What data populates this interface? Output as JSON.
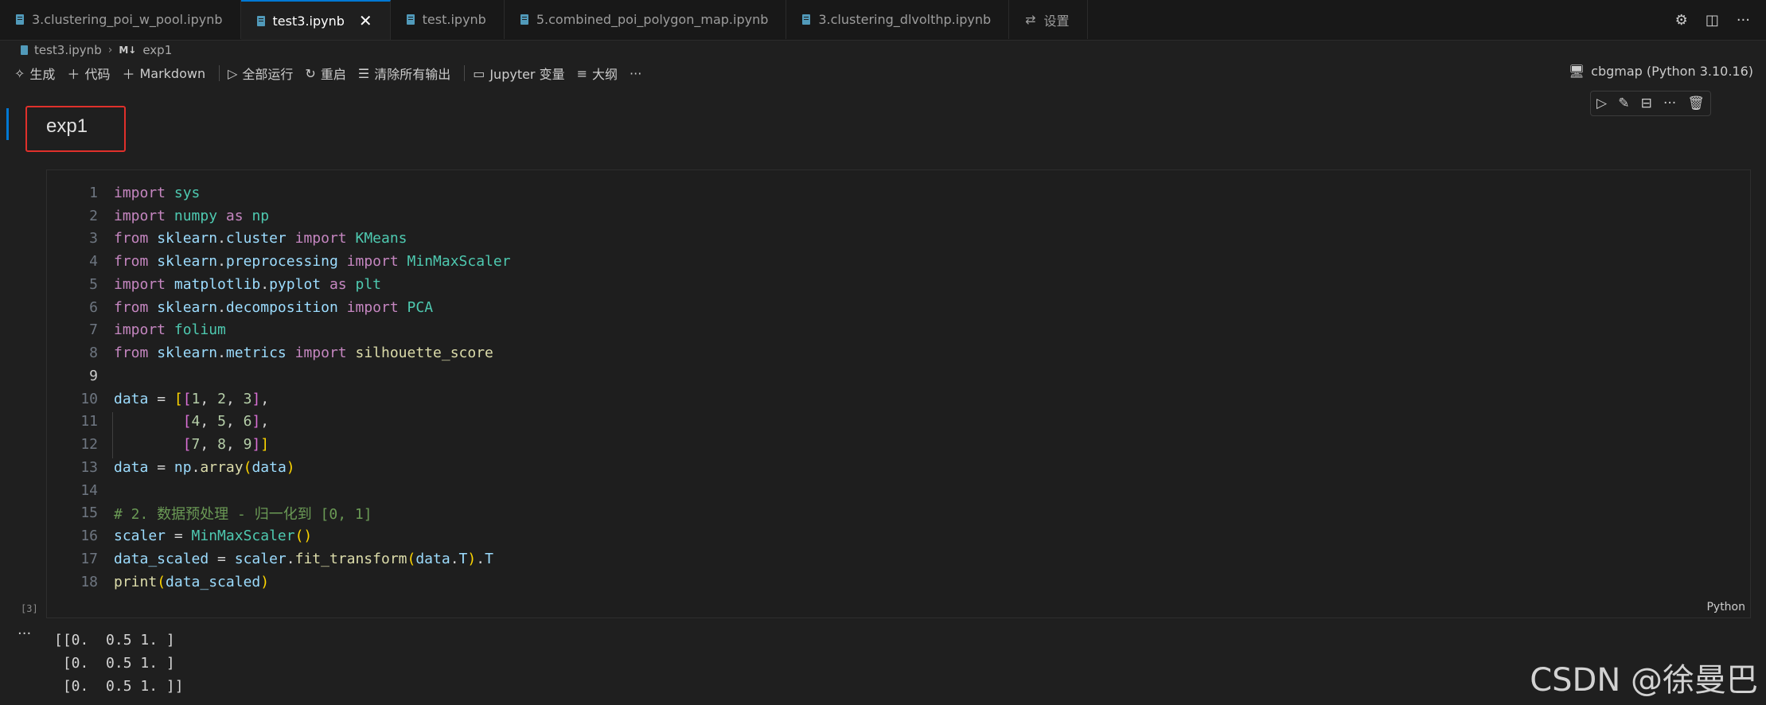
{
  "tabs": [
    {
      "label": "3.clustering_poi_w_pool.ipynb",
      "active": false
    },
    {
      "label": "test3.ipynb",
      "active": true
    },
    {
      "label": "test.ipynb",
      "active": false
    },
    {
      "label": "5.combined_poi_polygon_map.ipynb",
      "active": false
    },
    {
      "label": "3.clustering_dlvolthp.ipynb",
      "active": false
    },
    {
      "label": "设置",
      "active": false
    }
  ],
  "breadcrumb": {
    "file": "test3.ipynb",
    "badge": "M↓",
    "section": "exp1"
  },
  "toolbar": {
    "generate": "生成",
    "code": "代码",
    "markdown": "Markdown",
    "run_all": "全部运行",
    "restart": "重启",
    "clear_outputs": "清除所有输出",
    "jupyter_vars": "Jupyter 变量",
    "outline": "大纲",
    "more": "···"
  },
  "kernel": "cbgmap (Python 3.10.16)",
  "markdown_cell": {
    "text": "exp1"
  },
  "code_cell": {
    "execution_count": "[3]",
    "language": "Python",
    "line_numbers": [
      "1",
      "2",
      "3",
      "4",
      "5",
      "6",
      "7",
      "8",
      "9",
      "10",
      "11",
      "12",
      "13",
      "14",
      "15",
      "16",
      "17",
      "18"
    ]
  },
  "output_lines": [
    "[[0.  0.5 1. ]",
    " [0.  0.5 1. ]",
    " [0.  0.5 1. ]]"
  ],
  "watermark": "CSDN @徐曼巴",
  "icons": {
    "tab_file": "notebook-file-icon",
    "settings": "gear-icon",
    "split": "split-editor-icon"
  }
}
